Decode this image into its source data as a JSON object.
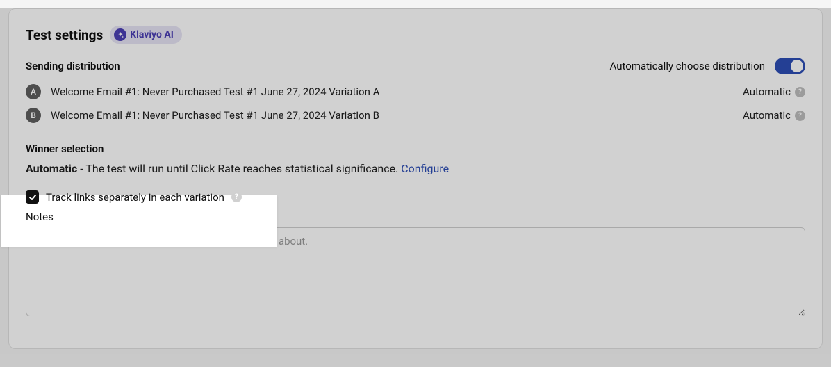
{
  "header": {
    "title": "Test settings",
    "ai_badge": "Klaviyo AI"
  },
  "sending_distribution": {
    "label": "Sending distribution",
    "auto_choose_label": "Automatically choose distribution",
    "toggle_on": true,
    "variations": [
      {
        "badge": "A",
        "name": "Welcome Email #1: Never Purchased Test #1 June 27, 2024 Variation A",
        "mode": "Automatic"
      },
      {
        "badge": "B",
        "name": "Welcome Email #1: Never Purchased Test #1 June 27, 2024 Variation B",
        "mode": "Automatic"
      }
    ]
  },
  "winner_selection": {
    "label": "Winner selection",
    "mode": "Automatic",
    "description": " - The test will run until Click Rate reaches statistical significance. ",
    "configure_label": "Configure"
  },
  "track_links": {
    "label": "Track links separately in each variation",
    "checked": true
  },
  "notes": {
    "label": "Notes",
    "placeholder": "Add a description to help remember what this test is about.",
    "value": ""
  },
  "icons": {
    "help": "?"
  }
}
